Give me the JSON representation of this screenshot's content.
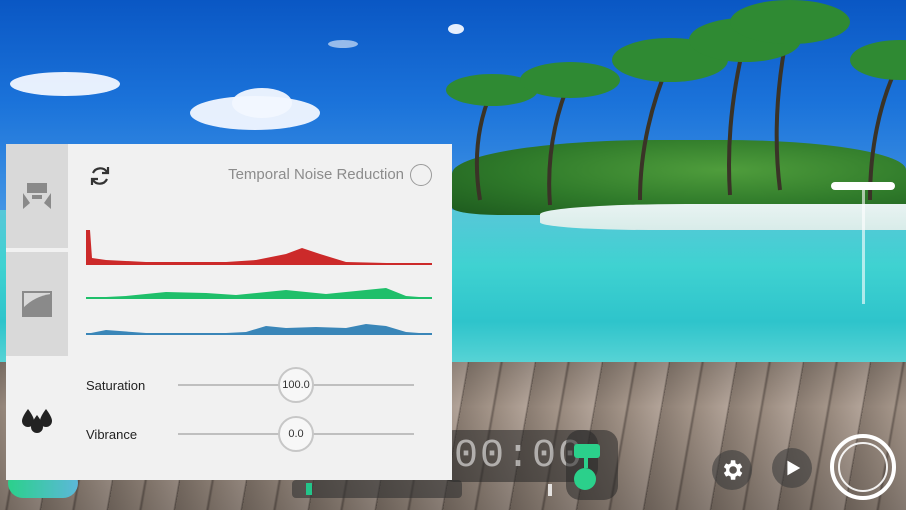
{
  "panel": {
    "temporal_noise_reduction_label": "Temporal Noise Reduction",
    "temporal_noise_reduction_enabled": false,
    "tabs": [
      {
        "icon": "exposure-icon"
      },
      {
        "icon": "curves-icon"
      },
      {
        "icon": "color-drops-icon"
      }
    ],
    "histogram_colors": {
      "red": "#cc2a2a",
      "green": "#1fbf6a",
      "blue": "#3a86b8"
    },
    "sliders": [
      {
        "label": "Saturation",
        "value": "100.0"
      },
      {
        "label": "Vibrance",
        "value": "0.0"
      }
    ]
  },
  "camera": {
    "timer": "00:00",
    "accent_color": "#2bd08b",
    "icons": [
      "settings-gear-icon",
      "play-icon",
      "record-icon"
    ]
  }
}
